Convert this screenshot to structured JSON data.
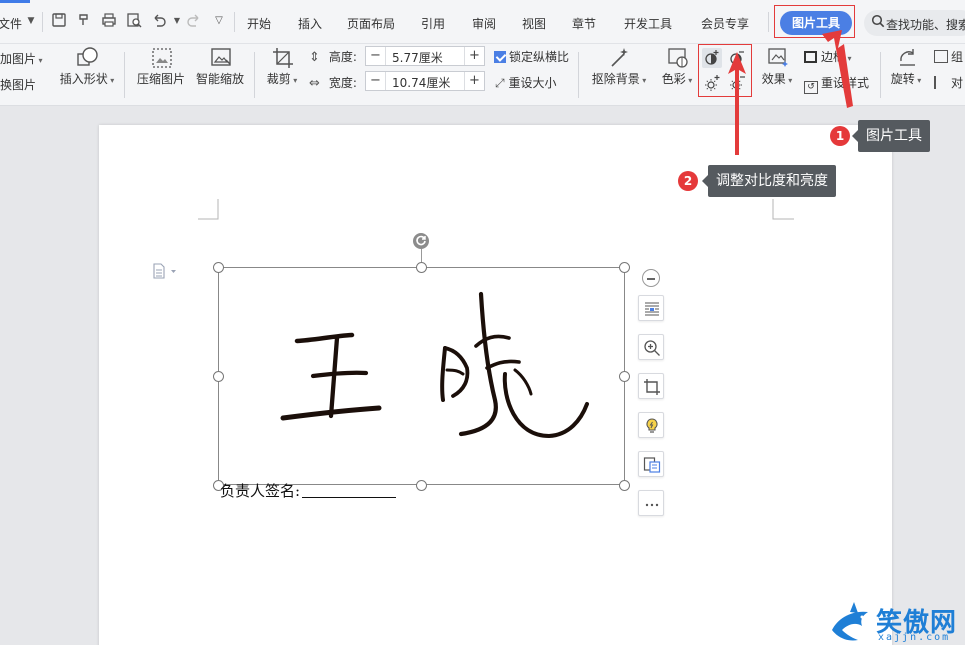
{
  "menubar": {
    "file_label": "文件",
    "tabs": [
      "开始",
      "插入",
      "页面布局",
      "引用",
      "审阅",
      "视图",
      "章节",
      "开发工具",
      "会员专享"
    ],
    "active_tab": "图片工具",
    "search_text": "查找功能、搜索"
  },
  "ribbon": {
    "add_picture": "加图片",
    "change_picture": "换图片",
    "insert_shape": "插入形状",
    "compress_picture": "压缩图片",
    "smart_zoom": "智能缩放",
    "crop": "裁剪",
    "height_label": "高度:",
    "height_value": "5.77厘米",
    "width_label": "宽度:",
    "width_value": "10.74厘米",
    "lock_ratio": "锁定纵横比",
    "reset_size": "重设大小",
    "remove_bg": "抠除背景",
    "color": "色彩",
    "effects": "效果",
    "border": "边框",
    "reset_style": "重设样式",
    "rotate": "旋转",
    "group": "组",
    "align": "对"
  },
  "document": {
    "caption_label": "负责人签名:",
    "signature_alt": "王晓"
  },
  "annotations": [
    {
      "number": "1",
      "text": "图片工具"
    },
    {
      "number": "2",
      "text": "调整对比度和亮度"
    }
  ],
  "watermark": {
    "brand": "笑傲网",
    "url": "xajjn.com"
  },
  "colors": {
    "accent": "#4b7fe4",
    "annotation_red": "#e33b3b",
    "tooltip_bg": "#555a5f",
    "watermark_blue": "#1f7fd6"
  }
}
